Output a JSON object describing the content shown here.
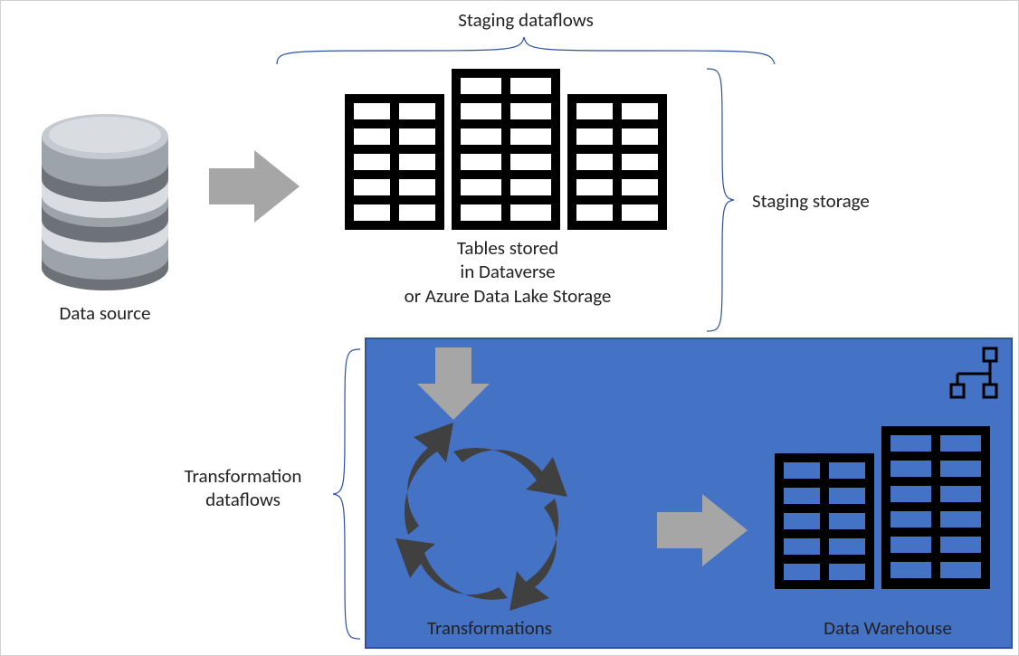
{
  "labels": {
    "staging_dataflows": "Staging dataflows",
    "data_source": "Data source",
    "tables_stored_line1": "Tables stored",
    "tables_stored_line2": "in Dataverse",
    "tables_stored_line3": "or Azure Data Lake Storage",
    "staging_storage": "Staging storage",
    "transformation_dataflows_line1": "Transformation",
    "transformation_dataflows_line2": "dataflows",
    "transformations": "Transformations",
    "data_warehouse": "Data Warehouse"
  },
  "colors": {
    "panel_fill": "#4472C4",
    "panel_stroke": "#2F5497",
    "arrow_gray": "#A6A6A6",
    "cycle_gray": "#404040",
    "brace_stroke": "#2E52A3",
    "cyl_top": "#B7BEC4",
    "cyl_mid": "#9CA3A9",
    "cyl_shadow": "#6C7278",
    "cyl_light": "#D9DDE1"
  }
}
